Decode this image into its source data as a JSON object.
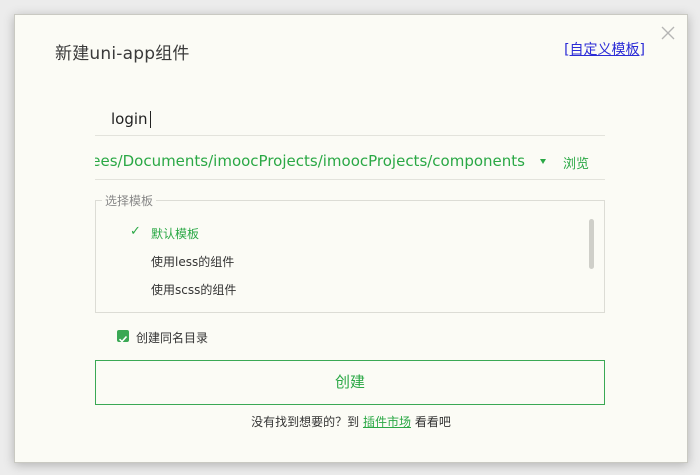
{
  "dialog": {
    "title": "新建uni-app组件",
    "custom_template_link": {
      "bracket_open": "[",
      "label": "自定义模板",
      "bracket_close": "]"
    },
    "close_icon": "close-icon"
  },
  "form": {
    "component_name": {
      "value": "login",
      "placeholder": ""
    },
    "location": {
      "path": "/Users/hovees/Documents/imoocProjects/imoocProjects/components",
      "browse_label": "浏览",
      "dropdown_icon": "chevron-down-icon"
    },
    "template_group": {
      "legend": "选择模板",
      "items": [
        {
          "label": "默认模板",
          "selected": true
        },
        {
          "label": "使用less的组件",
          "selected": false
        },
        {
          "label": "使用scss的组件",
          "selected": false
        }
      ],
      "selected_icon": "check-icon"
    },
    "create_same_name_dir": {
      "label": "创建同名目录",
      "checked": true
    },
    "create_button_label": "创建"
  },
  "footer": {
    "prefix": "没有找到想要的？到",
    "link_label": "插件市场",
    "suffix": "看看吧"
  },
  "colors": {
    "accent": "#2aa845",
    "dialog_bg": "#fbfbf5",
    "window_bg": "#ececec",
    "link_blue": "#2b2bd6"
  }
}
